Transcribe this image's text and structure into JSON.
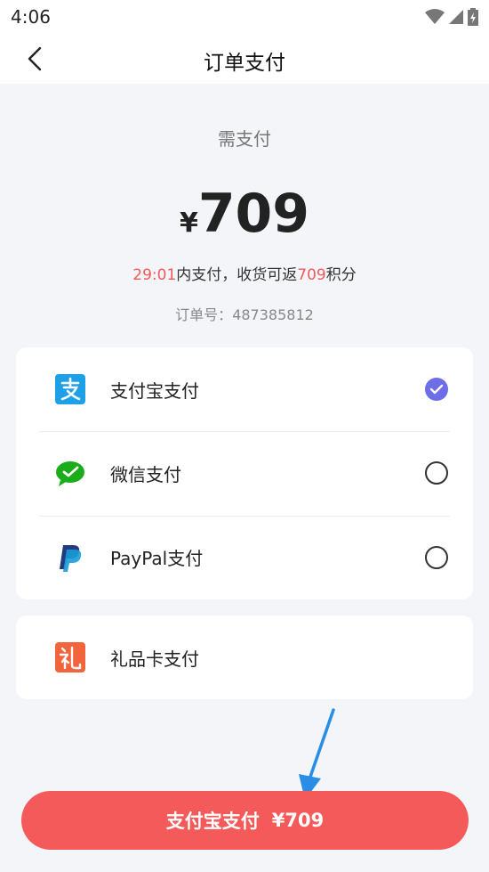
{
  "status_bar": {
    "time": "4:06"
  },
  "header": {
    "title": "订单支付"
  },
  "payment": {
    "amount_label": "需支付",
    "currency": "¥",
    "amount": "709",
    "countdown": "29:01",
    "countdown_suffix": "内支付，收货可返",
    "points": "709",
    "points_suffix": "积分",
    "order_label": "订单号：",
    "order_no": "487385812"
  },
  "methods": [
    {
      "label": "支付宝支付",
      "selected": true,
      "icon": "alipay-icon"
    },
    {
      "label": "微信支付",
      "selected": false,
      "icon": "wechat-icon"
    },
    {
      "label": "PayPal支付",
      "selected": false,
      "icon": "paypal-icon"
    }
  ],
  "giftcard": {
    "label": "礼品卡支付",
    "icon": "gift-icon"
  },
  "pay_button": {
    "label": "支付宝支付",
    "amount": "¥709"
  },
  "colors": {
    "accent_red": "#f55a5a",
    "check_purple": "#6d6de8",
    "alipay_blue": "#1ea0e6",
    "wechat_green": "#1aad19",
    "annotation_blue": "#2a8ee6"
  }
}
